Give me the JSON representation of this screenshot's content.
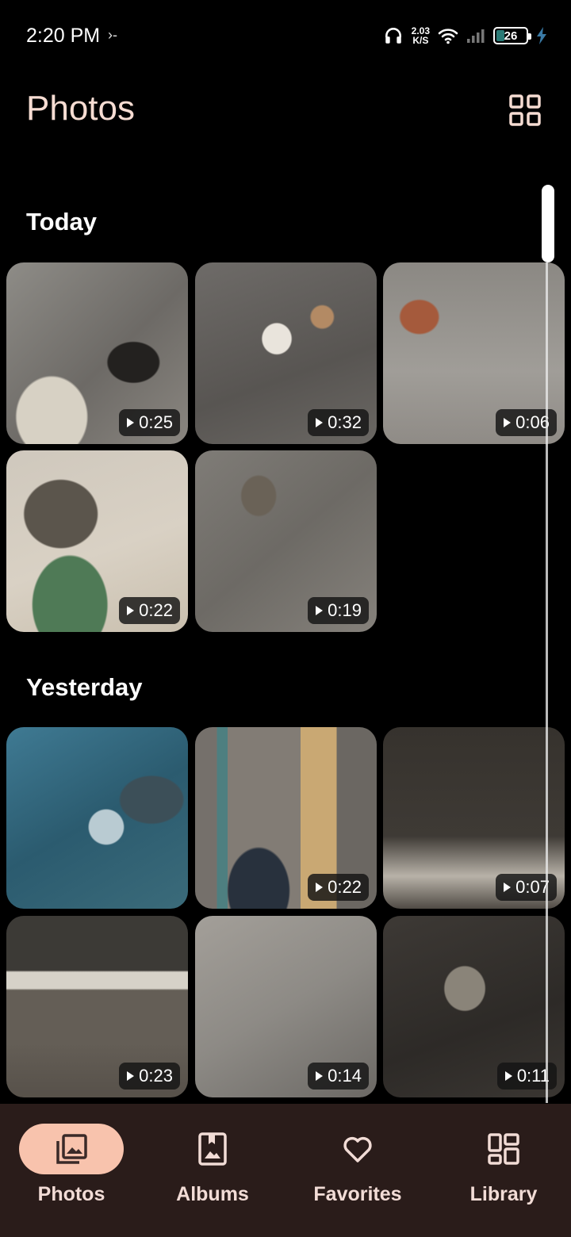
{
  "status_bar": {
    "time": "2:20 PM",
    "net_speed_value": "2.03",
    "net_speed_unit": "K/S",
    "battery": "26"
  },
  "header": {
    "title": "Photos"
  },
  "sections": [
    {
      "title": "Today",
      "items": [
        {
          "duration": "0:25"
        },
        {
          "duration": "0:32"
        },
        {
          "duration": "0:06"
        },
        {
          "duration": "0:22"
        },
        {
          "duration": "0:19"
        }
      ]
    },
    {
      "title": "Yesterday",
      "items": [
        {
          "duration": ""
        },
        {
          "duration": "0:22"
        },
        {
          "duration": "0:07"
        },
        {
          "duration": "0:23"
        },
        {
          "duration": "0:14"
        },
        {
          "duration": "0:11"
        }
      ]
    }
  ],
  "nav": [
    {
      "label": "Photos",
      "icon": "photos-icon",
      "active": true
    },
    {
      "label": "Albums",
      "icon": "albums-icon",
      "active": false
    },
    {
      "label": "Favorites",
      "icon": "heart-icon",
      "active": false
    },
    {
      "label": "Library",
      "icon": "library-icon",
      "active": false
    }
  ],
  "colors": {
    "title": "#f6dcd2",
    "nav_bg": "#2a1c1a",
    "nav_active_pill": "#f8c3ad",
    "nav_label": "#f2dcd6"
  }
}
